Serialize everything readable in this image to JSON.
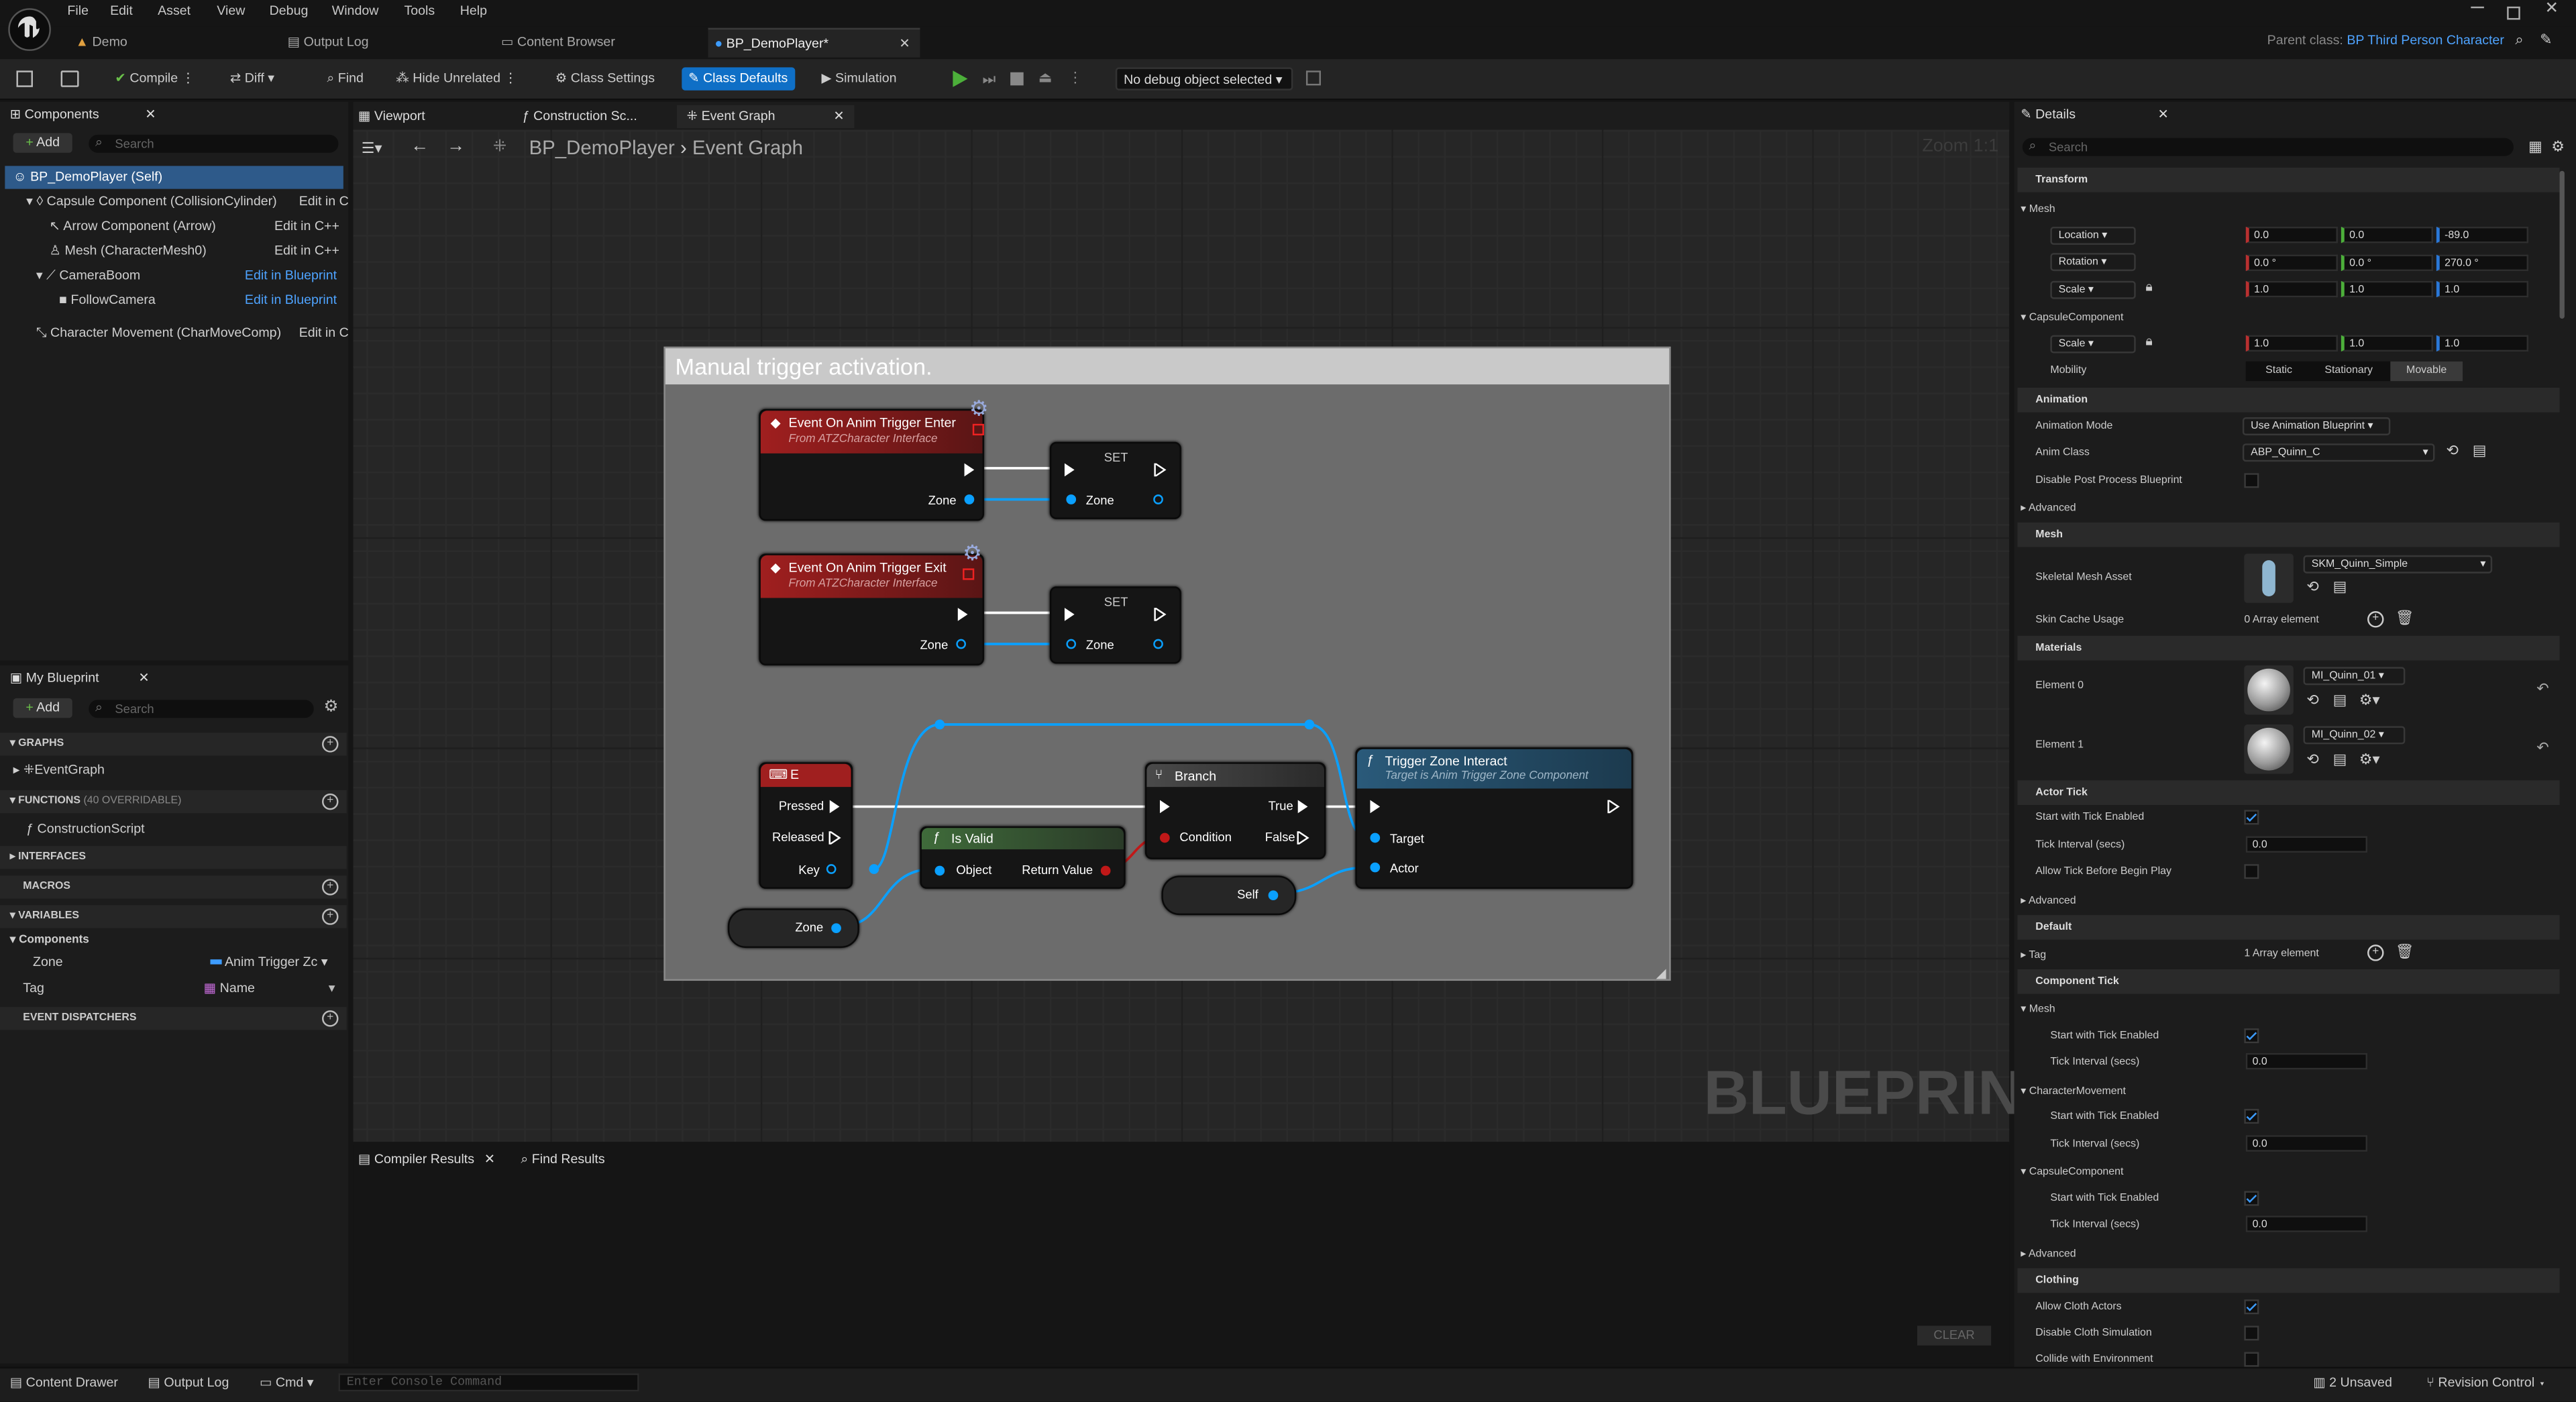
{
  "menu": [
    "File",
    "Edit",
    "Asset",
    "View",
    "Debug",
    "Window",
    "Tools",
    "Help"
  ],
  "doc_tabs": [
    {
      "label": "Demo"
    },
    {
      "label": "Output Log"
    },
    {
      "label": "Content Browser"
    },
    {
      "label": "BP_DemoPlayer*"
    }
  ],
  "parent_class": {
    "label": "Parent class:",
    "value": "BP Third Person Character"
  },
  "toolbar": {
    "compile": "Compile",
    "diff": "Diff",
    "find": "Find",
    "hide_unrelated": "Hide Unrelated",
    "class_settings": "Class Settings",
    "class_defaults": "Class Defaults",
    "simulation": "Simulation",
    "debug_object": "No debug object selected"
  },
  "components": {
    "tab": "Components",
    "add": "Add",
    "search_placeholder": "Search",
    "items": [
      {
        "name": "BP_DemoPlayer (Self)",
        "action": ""
      },
      {
        "name": "Capsule Component (CollisionCylinder)",
        "action": "Edit in C"
      },
      {
        "name": "Arrow Component (Arrow)",
        "action": "Edit in C++"
      },
      {
        "name": "Mesh (CharacterMesh0)",
        "action": "Edit in C++"
      },
      {
        "name": "CameraBoom",
        "action": "Edit in Blueprint"
      },
      {
        "name": "FollowCamera",
        "action": "Edit in Blueprint"
      },
      {
        "name": "Character Movement (CharMoveComp)",
        "action": "Edit in C"
      }
    ]
  },
  "my_blueprint": {
    "tab": "My Blueprint",
    "add": "Add",
    "search_placeholder": "Search",
    "graphs": "GRAPHS",
    "event_graph": "EventGraph",
    "functions": "FUNCTIONS",
    "functions_note": "(40 OVERRIDABLE)",
    "construction": "ConstructionScript",
    "interfaces": "INTERFACES",
    "macros": "MACROS",
    "variables": "VARIABLES",
    "components_cat": "Components",
    "vars": [
      {
        "name": "Zone",
        "type": "Anim Trigger Zc"
      },
      {
        "name": "Tag",
        "type": "Name"
      }
    ],
    "dispatchers": "EVENT DISPATCHERS"
  },
  "graph_tabs": [
    "Viewport",
    "Construction Sc...",
    "Event Graph"
  ],
  "breadcrumb": {
    "root": "BP_DemoPlayer",
    "current": "Event Graph"
  },
  "zoom": "Zoom 1:1",
  "watermark": "BLUEPRINT",
  "comment": "Manual trigger activation.",
  "nodes": {
    "enter": {
      "title": "Event On Anim Trigger Enter",
      "sub": "From ATZCharacter Interface",
      "pin": "Zone"
    },
    "exit": {
      "title": "Event On Anim Trigger Exit",
      "sub": "From ATZCharacter Interface",
      "pin": "Zone"
    },
    "set": "SET",
    "set_pin": "Zone",
    "key": {
      "title": "E",
      "pressed": "Pressed",
      "released": "Released",
      "key": "Key"
    },
    "isvalid": {
      "title": "Is Valid",
      "object": "Object",
      "ret": "Return Value"
    },
    "branch": {
      "title": "Branch",
      "condition": "Condition",
      "true": "True",
      "false": "False"
    },
    "interact": {
      "title": "Trigger Zone Interact",
      "sub": "Target is Anim Trigger Zone Component",
      "target": "Target",
      "actor": "Actor"
    },
    "self": "Self",
    "zone": "Zone"
  },
  "bottom": {
    "compiler": "Compiler Results",
    "find": "Find Results",
    "clear": "CLEAR"
  },
  "details": {
    "tab": "Details",
    "search_placeholder": "Search",
    "transform": "Transform",
    "mesh": "Mesh",
    "location": "Location",
    "rotation": "Rotation",
    "scale": "Scale",
    "loc": [
      "0.0",
      "0.0",
      "-89.0"
    ],
    "rot": [
      "0.0 °",
      "0.0 °",
      "270.0 °"
    ],
    "scl": [
      "1.0",
      "1.0",
      "1.0"
    ],
    "capsule": "CapsuleComponent",
    "cap_scl": [
      "1.0",
      "1.0",
      "1.0"
    ],
    "mobility": "Mobility",
    "mob_opts": [
      "Static",
      "Stationary",
      "Movable"
    ],
    "animation": "Animation",
    "anim_mode": "Animation Mode",
    "anim_mode_val": "Use Animation Blueprint",
    "anim_class": "Anim Class",
    "anim_class_val": "ABP_Quinn_C",
    "disable_pp": "Disable Post Process Blueprint",
    "advanced": "Advanced",
    "mesh_sec": "Mesh",
    "skel": "Skeletal Mesh Asset",
    "skel_val": "SKM_Quinn_Simple",
    "skin_cache": "Skin Cache Usage",
    "skin_cache_val": "0 Array element",
    "materials": "Materials",
    "el0": "Element 0",
    "el0_val": "MI_Quinn_01",
    "el1": "Element 1",
    "el1_val": "MI_Quinn_02",
    "actor_tick": "Actor Tick",
    "start_tick": "Start with Tick Enabled",
    "tick_interval": "Tick Interval (secs)",
    "tick_val": "0.0",
    "allow_tick": "Allow Tick Before Begin Play",
    "default": "Default",
    "tag": "Tag",
    "tag_val": "1 Array element",
    "comp_tick": "Component Tick",
    "mesh2": "Mesh",
    "charmove": "CharacterMovement",
    "capsule2": "CapsuleComponent",
    "clothing": "Clothing",
    "allow_cloth": "Allow Cloth Actors",
    "disable_cloth": "Disable Cloth Simulation",
    "collide_env": "Collide with Environment"
  },
  "status": {
    "content_drawer": "Content Drawer",
    "output_log": "Output Log",
    "cmd": "Cmd",
    "console_placeholder": "Enter Console Command",
    "unsaved": "2 Unsaved",
    "revision": "Revision Control"
  }
}
